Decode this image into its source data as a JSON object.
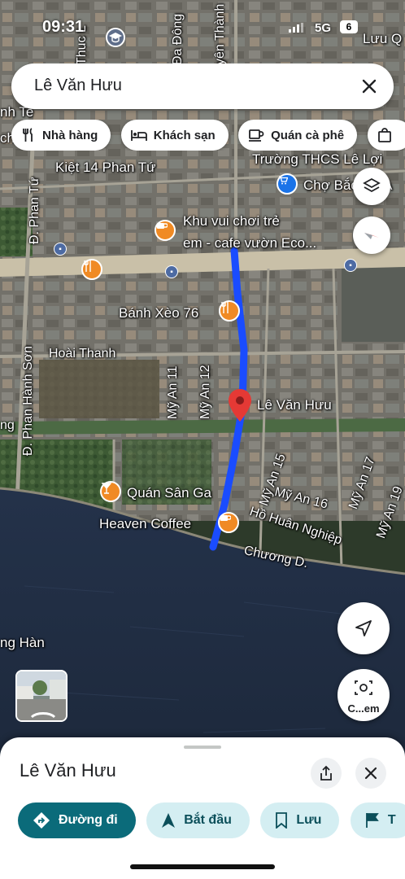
{
  "status_bar": {
    "time": "09:31",
    "network": "5G",
    "battery": "6"
  },
  "search": {
    "query": "Lê Văn Hưu"
  },
  "chips": [
    {
      "icon": "restaurant-icon",
      "label": "Nhà hàng"
    },
    {
      "icon": "hotel-icon",
      "label": "Khách sạn"
    },
    {
      "icon": "cafe-icon",
      "label": "Quán cà phê"
    },
    {
      "icon": "shopping-icon",
      "label": ""
    }
  ],
  "map_labels": {
    "top_left_street": "Thuc L",
    "da_dong": "Đa Đông",
    "yen_thanh": "yên Thành",
    "luu_q": "Lưu Q",
    "anh_te": "nh Te",
    "chi": "chi",
    "kiet_14": "Kiệt 14 Phan Tứ",
    "phan_tu": "Đ. Phan Tứ",
    "truong_thcs": "Trường THCS Lê Lợi",
    "cho_bac_my_an": "Chợ Bắc Mỹ A",
    "khu_vui_choi_1": "Khu vui chơi trẻ",
    "khu_vui_choi_2": "em - cafe vườn Eco...",
    "banh_xeo": "Bánh Xèo 76",
    "hoai_thanh": "Hoài Thanh",
    "phan_hanh_son": "Đ. Phan Hành Sơn",
    "my_an_11": "Mỹ An 11",
    "my_an_12": "Mỹ An 12",
    "le_van_huu": "Lê Văn Hưu",
    "ng": "ng",
    "my_an_15": "Mỹ An 15",
    "my_an_16": "Mỹ An 16",
    "my_an_17": "Mỹ An 17",
    "my_an_19": "Mỹ An 19",
    "quan_san_ga": "Quán Sân Ga",
    "heaven_coffee": "Heaven Coffee",
    "ho_huan_nghiep": "Hồ Huân Nghiệp",
    "chuong_d": "Chương D.",
    "song_han": "ng Hàn"
  },
  "map_controls": {
    "lens_label": "C...em"
  },
  "sheet": {
    "place_name": "Lê Văn Hưu",
    "actions": [
      {
        "icon": "directions-icon",
        "label": "Đường đi",
        "style": "primary"
      },
      {
        "icon": "navigate-icon",
        "label": "Bắt đầu",
        "style": "secondary"
      },
      {
        "icon": "bookmark-icon",
        "label": "Lưu",
        "style": "secondary"
      },
      {
        "icon": "flag-icon",
        "label": "T",
        "style": "secondary"
      }
    ]
  },
  "colors": {
    "route": "#1a4cff",
    "pin": "#e53935",
    "poi_orange": "#f08a24",
    "primary": "#0b6b7a"
  }
}
